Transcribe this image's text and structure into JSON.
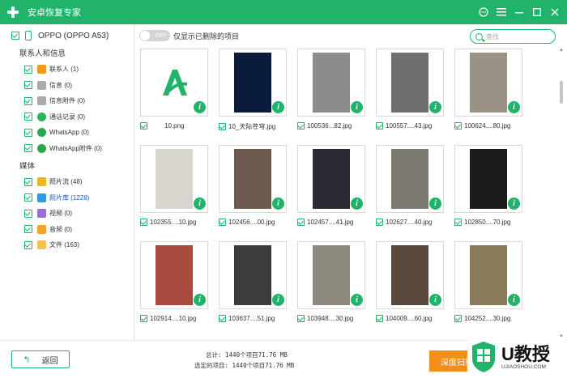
{
  "app": {
    "title": "安卓恢复专家"
  },
  "window_controls": [
    "chat-icon",
    "menu-icon",
    "minimize-icon",
    "maximize-icon",
    "close-icon"
  ],
  "sidebar": {
    "device": "OPPO (OPPO A53)",
    "groups": [
      {
        "title": "联系人和信息",
        "items": [
          {
            "label": "联系人 (1)",
            "icon": "contacts-icon"
          },
          {
            "label": "信息 (0)",
            "icon": "message-icon"
          },
          {
            "label": "信息附件 (0)",
            "icon": "attachment-icon"
          },
          {
            "label": "通话记录 (0)",
            "icon": "call-log-icon"
          },
          {
            "label": "WhatsApp (0)",
            "icon": "whatsapp-icon"
          },
          {
            "label": "WhatsApp附件 (0)",
            "icon": "whatsapp-attachment-icon"
          }
        ]
      },
      {
        "title": "媒体",
        "items": [
          {
            "label": "照片流 (48)",
            "icon": "photo-stream-icon"
          },
          {
            "label": "照片库 (1228)",
            "icon": "photo-library-icon",
            "active": true
          },
          {
            "label": "视频 (0)",
            "icon": "video-icon"
          },
          {
            "label": "音频 (0)",
            "icon": "audio-icon"
          },
          {
            "label": "文件 (163)",
            "icon": "folder-icon"
          }
        ]
      }
    ]
  },
  "toolbar": {
    "toggle_text": "OFF",
    "toggle_label": "仅显示已删除的项目",
    "search_placeholder": "查找"
  },
  "files": [
    "10.png",
    "10_天际苍穹.jpg",
    "100536...82.jpg",
    "100557....43.jpg",
    "100624....80.jpg",
    "102355....10.jpg",
    "102456....00.jpg",
    "102457....41.jpg",
    "102627....40.jpg",
    "102850....70.jpg",
    "102914....10.jpg",
    "103637....51.jpg",
    "103948....30.jpg",
    "104009....60.jpg",
    "104252....30.jpg"
  ],
  "thumb_colors": [
    "#ffffff",
    "#0a1a3a",
    "#8c8c8c",
    "#6f6f6f",
    "#9a9284",
    "#d8d5cf",
    "#6b5a4d",
    "#2a2a33",
    "#7d7a72",
    "#1c1c1c",
    "#a84a3c",
    "#3c3c3c",
    "#8e8a80",
    "#5a4a3e",
    "#8a7a5c"
  ],
  "footer": {
    "back_label": "返回",
    "total": "总计: 1440个项目71.76 MB",
    "selected": "选定的项目: 1440个项目71.76 MB",
    "deep_scan": "深度扫描"
  },
  "watermark": {
    "big": "U教授",
    "small": "UJIAOSHOU.COM"
  },
  "colors": {
    "accent": "#1fb46a",
    "orange": "#f18f1d"
  }
}
